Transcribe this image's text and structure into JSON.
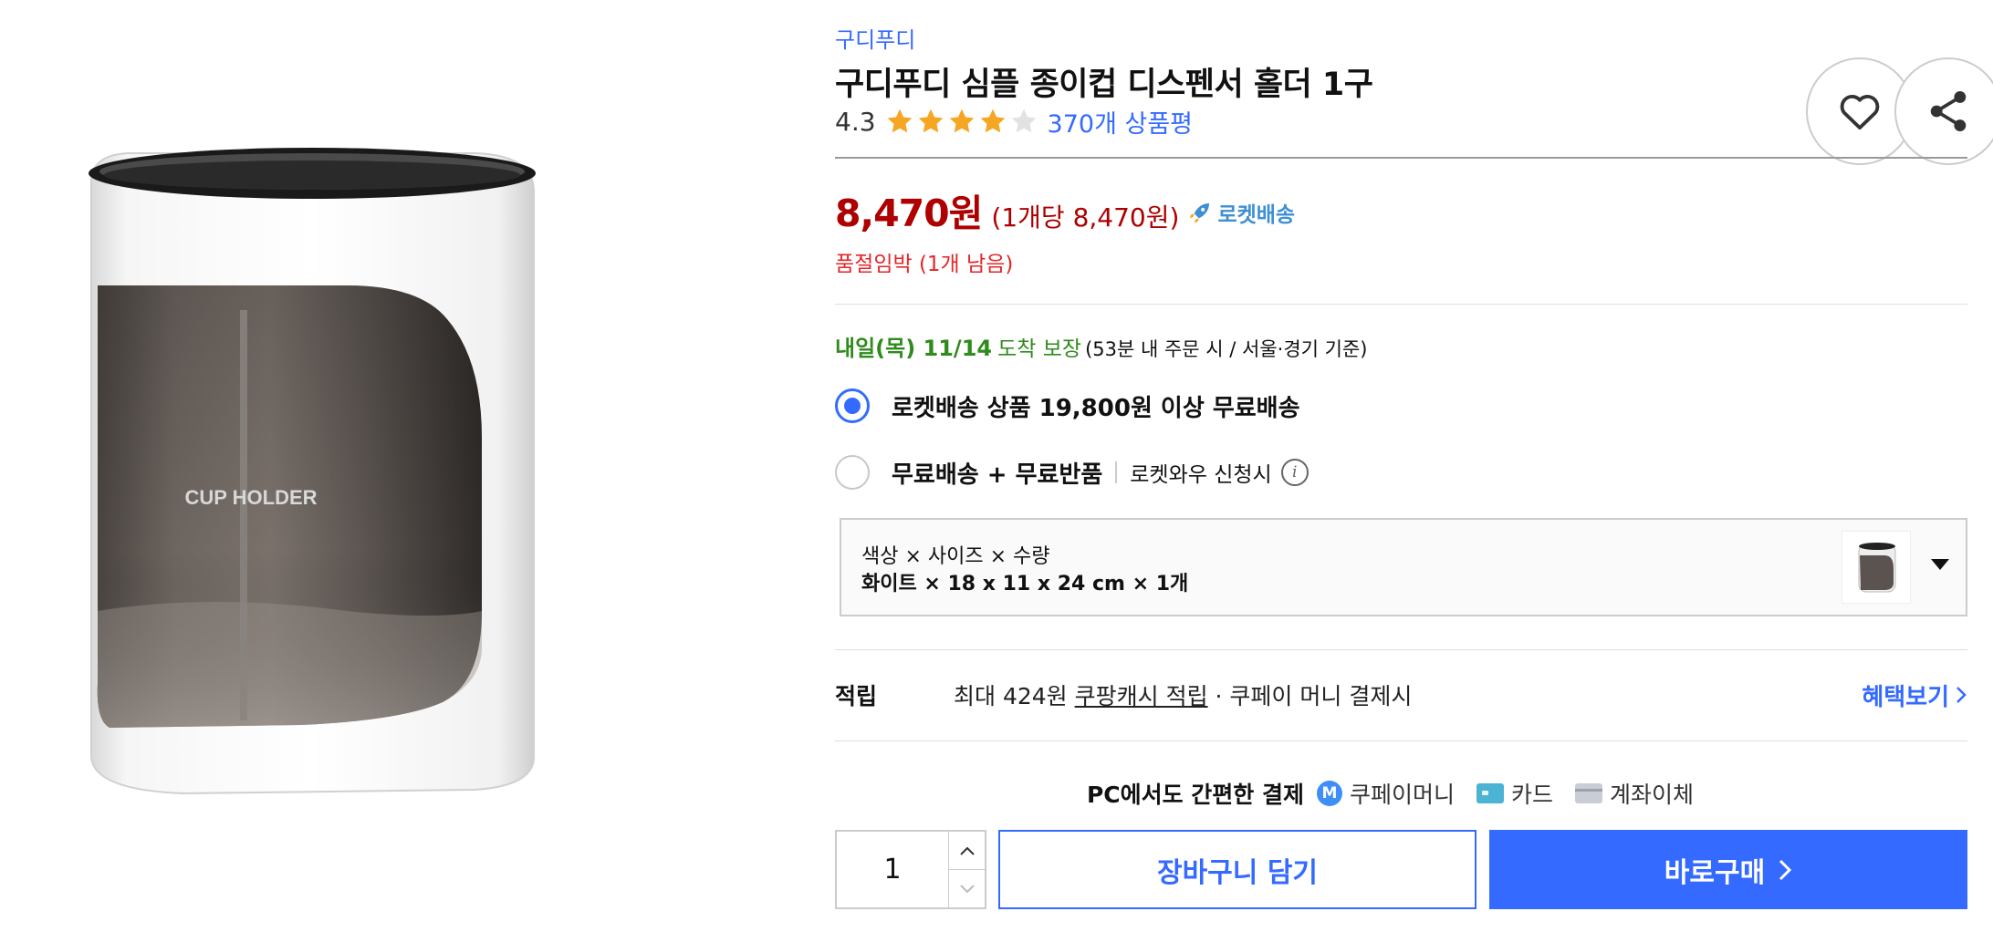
{
  "product": {
    "brand": "구디푸디",
    "title": "구디푸디 심플 종이컵 디스펜서 홀더 1구",
    "image_text": "CUP HOLDER",
    "rating": {
      "score": "4.3",
      "stars_filled": 4,
      "stars_total": 5,
      "reviews": "370개 상품평"
    }
  },
  "actions": {
    "heart_icon": "heart-icon",
    "share_icon": "share-icon"
  },
  "price": {
    "sale": "8,470원",
    "unit": "(1개당 8,470원)",
    "rocket_label": "로켓배송",
    "stock_notice": "품절임박 (1개 남음)"
  },
  "delivery": {
    "date": "내일(목) 11/14",
    "guarantee": "도착 보장",
    "condition": "(53분 내 주문 시 / 서울·경기 기준)"
  },
  "shipping_options": [
    {
      "label": "로켓배송 상품 19,800원 이상 무료배송",
      "checked": true
    },
    {
      "label": "무료배송 + 무료반품",
      "sub": "로켓와우 신청시",
      "checked": false
    }
  ],
  "option_select": {
    "label": "색상 × 사이즈 × 수량",
    "value": "화이트 × 18 x 11 x 24 cm × 1개"
  },
  "reward": {
    "title": "적립",
    "prefix": "최대 424원",
    "link": "쿠팡캐시 적립",
    "suffix": "· 쿠페이 머니 결제시",
    "benefit_link": "혜택보기"
  },
  "payment": {
    "title": "PC에서도 간편한 결제",
    "methods": [
      "쿠페이머니",
      "카드",
      "계좌이체"
    ],
    "m_badge": "M"
  },
  "purchase": {
    "quantity": "1",
    "cart_label": "장바구니 담기",
    "buy_label": "바로구매"
  },
  "colors": {
    "accent": "#346aff",
    "price": "#ae0000",
    "stock": "#e52528",
    "delivery": "#2e8b1c",
    "star": "#f5a623"
  }
}
